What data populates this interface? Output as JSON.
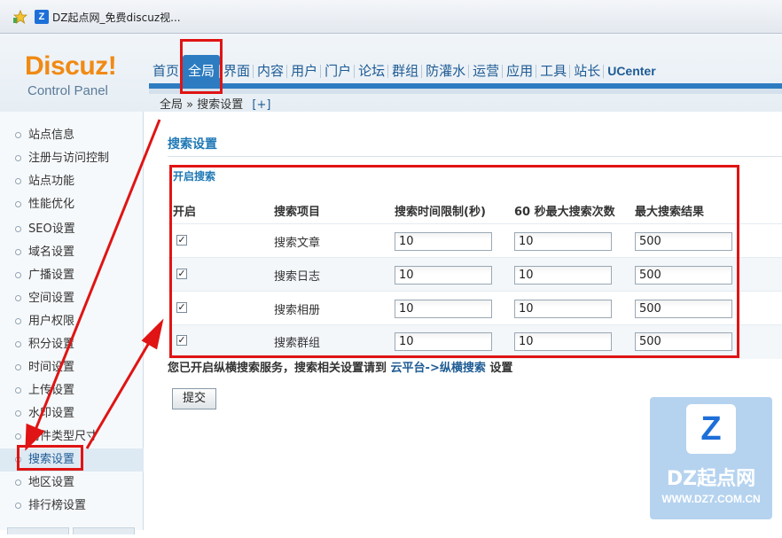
{
  "browser": {
    "tab_icon": "DZ-logo-icon",
    "tab_icon_text": "Z",
    "tab_title": "DZ起点网_免费discuz视..."
  },
  "logo": {
    "word": "Discuz!",
    "sub": "Control Panel"
  },
  "nav": {
    "items": [
      "首页",
      "全局",
      "界面",
      "内容",
      "用户",
      "门户",
      "论坛",
      "群组",
      "防灌水",
      "运营",
      "应用",
      "工具",
      "站长",
      "UCenter"
    ],
    "active": "全局"
  },
  "breadcrumb": {
    "parent": "全局",
    "separator": "»",
    "current": "搜索设置",
    "plus": "[+]"
  },
  "sidebar": {
    "items": [
      "站点信息",
      "注册与访问控制",
      "站点功能",
      "性能优化",
      "SEO设置",
      "域名设置",
      "广播设置",
      "空间设置",
      "用户权限",
      "积分设置",
      "时间设置",
      "上传设置",
      "水印设置",
      "附件类型尺寸",
      "搜索设置",
      "地区设置",
      "排行榜设置"
    ],
    "active": "搜索设置"
  },
  "main": {
    "title": "搜索设置",
    "section_title": "开启搜索",
    "columns": [
      "开启",
      "搜索项目",
      "搜索时间限制(秒)",
      "60 秒最大搜索次数",
      "最大搜索结果"
    ],
    "rows": [
      {
        "enabled": true,
        "label": "搜索文章",
        "time_limit": "10",
        "max_per_60s": "10",
        "max_results": "500"
      },
      {
        "enabled": true,
        "label": "搜索日志",
        "time_limit": "10",
        "max_per_60s": "10",
        "max_results": "500"
      },
      {
        "enabled": true,
        "label": "搜索相册",
        "time_limit": "10",
        "max_per_60s": "10",
        "max_results": "500"
      },
      {
        "enabled": true,
        "label": "搜索群组",
        "time_limit": "10",
        "max_per_60s": "10",
        "max_results": "500"
      }
    ],
    "notice_prefix": "您已开启纵横搜索服务，搜索相关设置请到",
    "notice_link": "云平台->纵横搜索",
    "notice_suffix": "设置",
    "submit_label": "提交"
  },
  "watermark": {
    "logo_text": "Z",
    "name": "DZ起点网",
    "url": "WWW.DZ7.COM.CN"
  },
  "colors": {
    "accent": "#2d7cc1",
    "title": "#1e78b5",
    "annotation": "#e01414",
    "logo_orange": "#f08a14"
  }
}
